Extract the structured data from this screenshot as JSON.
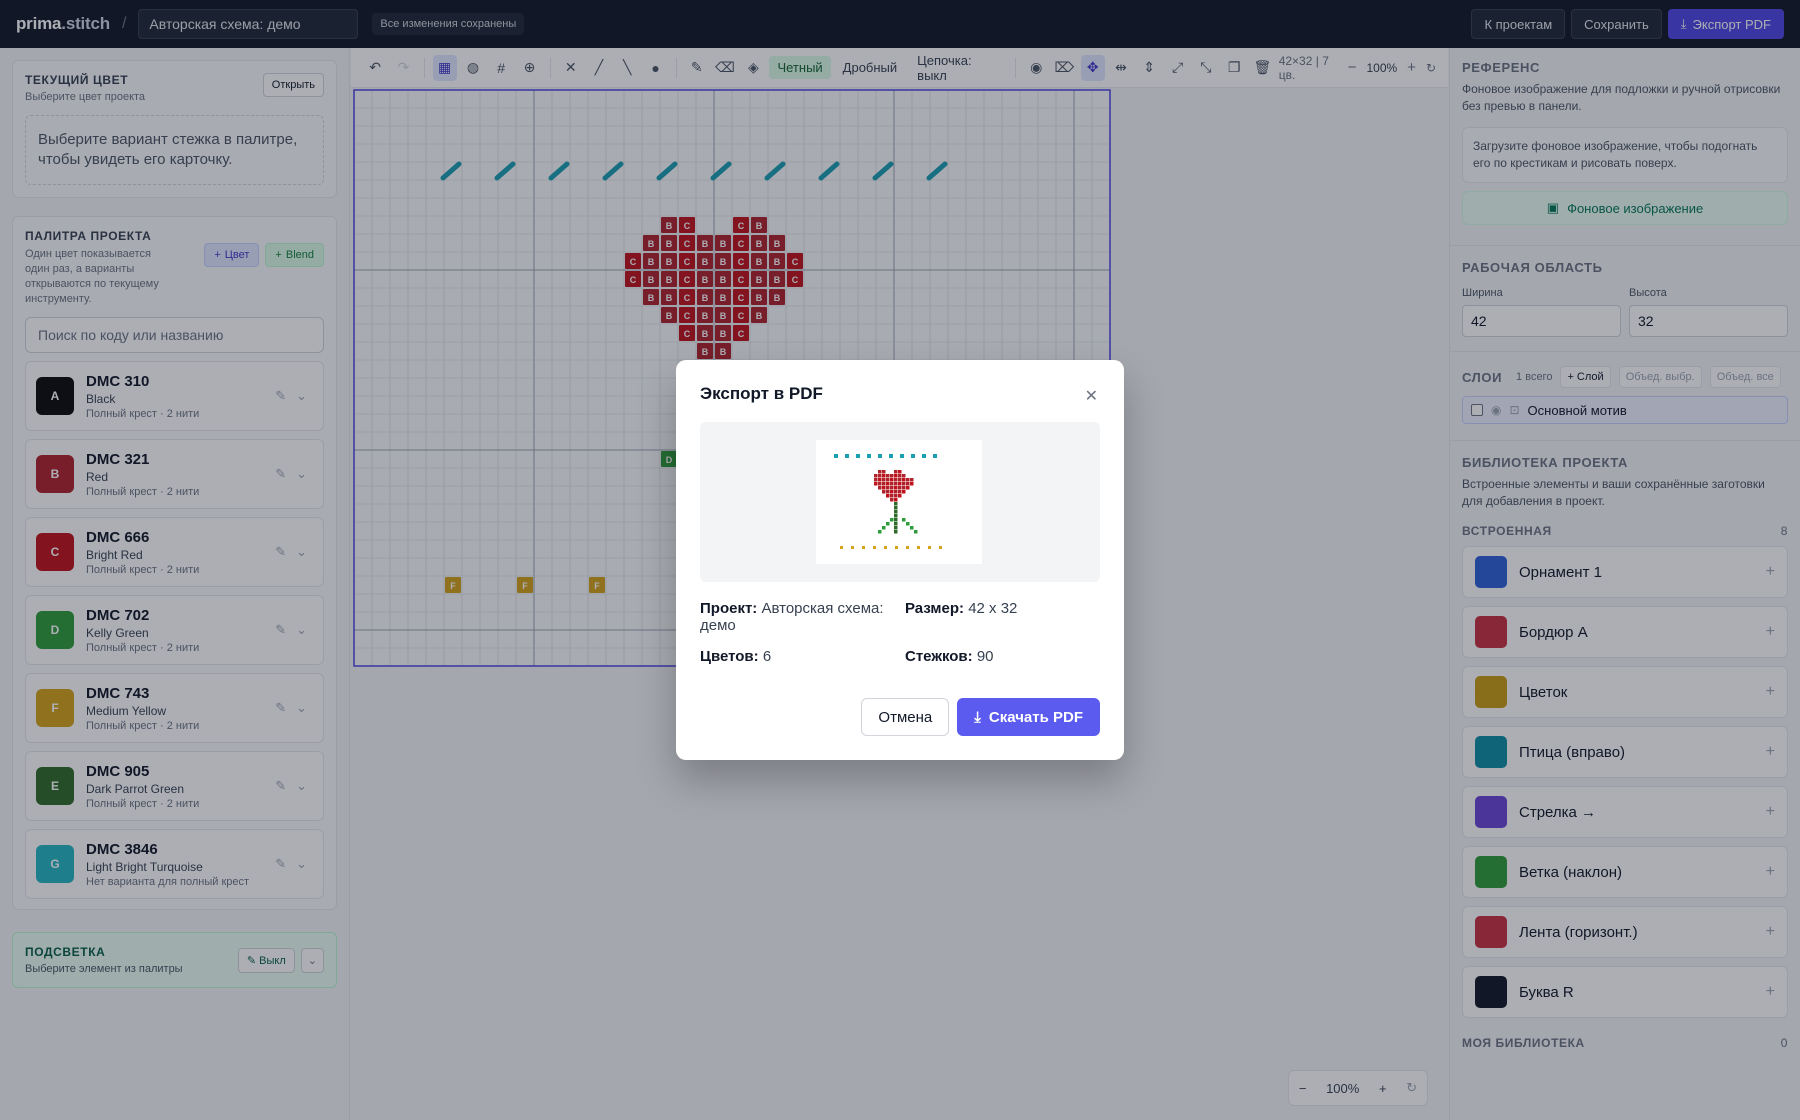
{
  "header": {
    "logo_bold": "prima",
    "logo_rest": ".stitch",
    "separator": "/",
    "project_name": "Авторская схема: демо",
    "saved_status": "Все изменения сохранены",
    "to_projects": "К проектам",
    "save": "Сохранить",
    "export_pdf": "Экспорт PDF"
  },
  "current_color": {
    "title": "ТЕКУЩИЙ ЦВЕТ",
    "subtitle": "Выберите цвет проекта",
    "open_btn": "Открыть",
    "hint": "Выберите вариант стежка в палитре, чтобы увидеть его карточку."
  },
  "palette": {
    "title": "ПАЛИТРА ПРОЕКТА",
    "subtitle": "Один цвет показывается один раз, а варианты открываются по текущему инструменту.",
    "add_color": "Цвет",
    "add_blend": "Blend",
    "search_placeholder": "Поиск по коду или названию",
    "threads": [
      {
        "letter": "A",
        "code": "DMC 310",
        "name": "Black",
        "meta": "Полный крест · 2 нити",
        "color": "#0b0b0b"
      },
      {
        "letter": "B",
        "code": "DMC 321",
        "name": "Red",
        "meta": "Полный крест · 2 нити",
        "color": "#b0232b"
      },
      {
        "letter": "C",
        "code": "DMC 666",
        "name": "Bright Red",
        "meta": "Полный крест · 2 нити",
        "color": "#c1121b"
      },
      {
        "letter": "D",
        "code": "DMC 702",
        "name": "Kelly Green",
        "meta": "Полный крест · 2 нити",
        "color": "#2e9b3a"
      },
      {
        "letter": "F",
        "code": "DMC 743",
        "name": "Medium Yellow",
        "meta": "Полный крест · 2 нити",
        "color": "#d4a41a"
      },
      {
        "letter": "E",
        "code": "DMC 905",
        "name": "Dark Parrot Green",
        "meta": "Полный крест · 2 нити",
        "color": "#2f6b28"
      },
      {
        "letter": "G",
        "code": "DMC 3846",
        "name": "Light Bright Turquoise",
        "meta": "Нет варианта для полный крест",
        "color": "#26b5c2"
      }
    ]
  },
  "highlight": {
    "title": "ПОДСВЕТКА",
    "subtitle": "Выберите элемент из палитры",
    "btn": "Выкл"
  },
  "toolbar": {
    "even": "Четный",
    "fractional": "Дробный",
    "chain": "Цепочка: выкл",
    "canvas_info": "42×32 | 7 цв.",
    "zoom": "100%"
  },
  "canvas": {
    "grid_cols": 42,
    "grid_rows": 32,
    "turquoise": "#1c9fb1",
    "stem_green": "#2e9b3a",
    "yellow": "#d4a41a",
    "red_b": "#b0232b",
    "red_c": "#c1121b",
    "grid_line": "#d1d5db",
    "major_line": "#9ca3af",
    "border": "#4f46e5"
  },
  "zoom_float": {
    "value": "100%"
  },
  "reference": {
    "title": "РЕФЕРЕНС",
    "subtitle": "Фоновое изображение для подложки и ручной отрисовки без превью в панели.",
    "hint": "Загрузите фоновое изображение, чтобы подогнать его по крестикам и рисовать поверх.",
    "bg_btn": "Фоновое изображение"
  },
  "workspace": {
    "title": "РАБОЧАЯ ОБЛАСТЬ",
    "width_label": "Ширина",
    "width": "42",
    "height_label": "Высота",
    "height": "32"
  },
  "layers": {
    "title": "СЛОИ",
    "count": "1 всего",
    "add": "+ Слой",
    "merge_sel": "Объед. выбр.",
    "merge_all": "Объед. все",
    "main_layer": "Основной мотив"
  },
  "library": {
    "title": "БИБЛИОТЕКА ПРОЕКТА",
    "subtitle": "Встроенные элементы и ваши сохранённые заготовки для добавления в проект.",
    "builtin_title": "ВСТРОЕННАЯ",
    "builtin_count": "8",
    "items": [
      {
        "name": "Орнамент 1",
        "color": "#2f62d6"
      },
      {
        "name": "Бордюр А",
        "color": "#c8313f"
      },
      {
        "name": "Цветок",
        "color": "#c89b14"
      },
      {
        "name": "Птица (вправо)",
        "color": "#0f8ea3"
      },
      {
        "name": "Стрелка →",
        "color": "#6b46d6"
      },
      {
        "name": "Ветка (наклон)",
        "color": "#2e9b3a"
      },
      {
        "name": "Лента (горизонт.)",
        "color": "#c8313f"
      },
      {
        "name": "Буква R",
        "color": "#111827"
      }
    ],
    "my_title": "МОЯ БИБЛИОТЕКА",
    "my_count": "0"
  },
  "modal": {
    "title": "Экспорт в PDF",
    "project_label": "Проект:",
    "project_value": "Авторская схема: демо",
    "size_label": "Размер:",
    "size_value": "42 x 32",
    "colors_label": "Цветов:",
    "colors_value": "6",
    "stitches_label": "Стежков:",
    "stitches_value": "90",
    "cancel": "Отмена",
    "download": "Скачать PDF"
  }
}
